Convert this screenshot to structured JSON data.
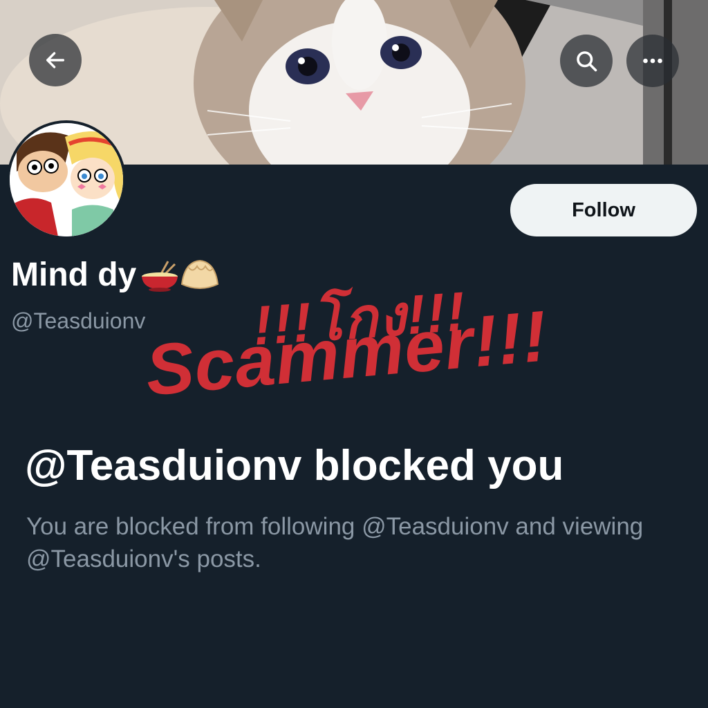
{
  "header": {
    "back_icon": "arrow-left-icon",
    "search_icon": "search-icon",
    "more_icon": "more-horizontal-icon",
    "banner": "cat-photo"
  },
  "profile": {
    "display_name": "Mind dy",
    "name_emojis": "🍲🥟",
    "handle": "@Teasduionv",
    "follow_label": "Follow"
  },
  "overlay": {
    "thai_text": "!!!โกง!!!",
    "scam_text": "Scammer!!!",
    "color": "#d02f36"
  },
  "blocked": {
    "title": "@Teasduionv blocked you",
    "description": "You are blocked from following @Teasduionv and viewing @Teasduionv's posts."
  },
  "colors": {
    "background": "#15202b",
    "secondary_text": "#8b98a5",
    "button_bg": "#eff3f4"
  }
}
